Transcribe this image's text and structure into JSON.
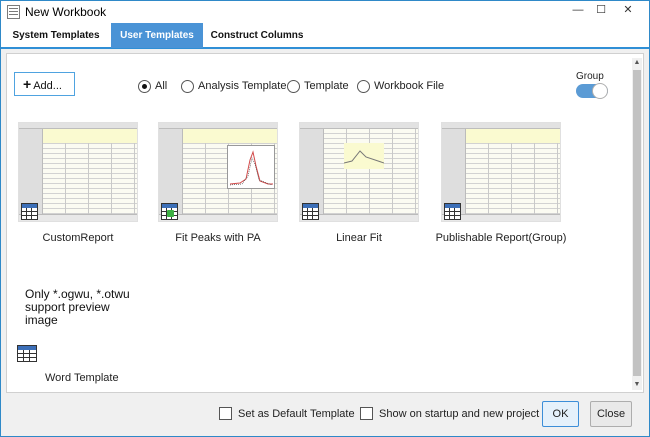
{
  "window": {
    "title": "New Workbook",
    "controls": {
      "minimize": "—",
      "maximize": "☐",
      "close": "✕"
    }
  },
  "tabs": [
    {
      "label": "System Templates",
      "active": false
    },
    {
      "label": "User Templates",
      "active": true
    },
    {
      "label": "Construct Columns",
      "active": false
    }
  ],
  "toolbar": {
    "add_label": "Add...",
    "filter_options": [
      {
        "label": "All",
        "selected": true
      },
      {
        "label": "Analysis Template",
        "selected": false
      },
      {
        "label": "Template",
        "selected": false
      },
      {
        "label": "Workbook File",
        "selected": false
      }
    ],
    "group_label": "Group",
    "group_enabled": true
  },
  "templates": [
    {
      "name": "CustomReport",
      "icon": "worksheet-icon"
    },
    {
      "name": "Fit Peaks with PA",
      "icon": "worksheet-icon"
    },
    {
      "name": "Linear Fit",
      "icon": "worksheet-icon"
    },
    {
      "name": "Publishable Report(Group)",
      "icon": "worksheet-icon"
    }
  ],
  "preview_note": "Only *.ogwu, *.otwu support preview image",
  "word_template": {
    "name": "Word Template",
    "icon": "table-icon"
  },
  "footer": {
    "set_default_label": "Set as Default Template",
    "set_default_checked": false,
    "show_startup_label": "Show on startup and new project",
    "show_startup_checked": false,
    "ok_label": "OK",
    "close_label": "Close"
  },
  "colors": {
    "accent": "#4a93d6",
    "border": "#2f89c8",
    "toggle": "#5b9bd5"
  }
}
